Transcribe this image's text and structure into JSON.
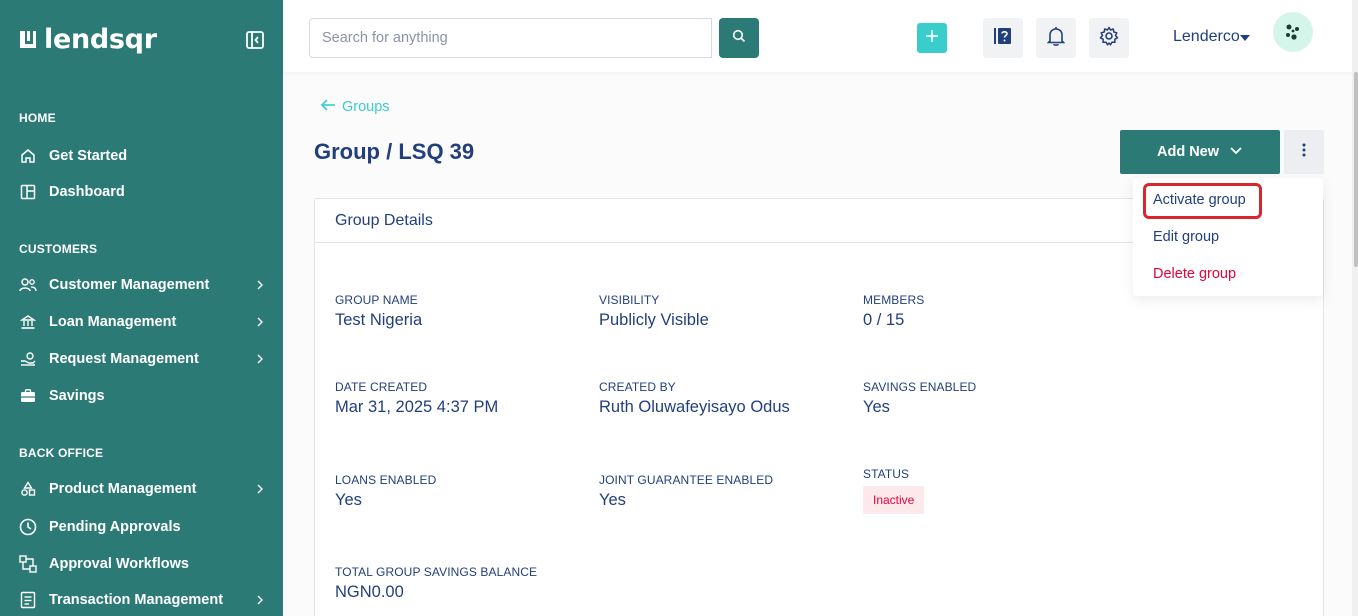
{
  "brand": {
    "name": "lendsqr"
  },
  "sidebar": {
    "sections": [
      {
        "title": "HOME"
      },
      {
        "title": "CUSTOMERS"
      },
      {
        "title": "BACK OFFICE"
      }
    ],
    "items": [
      {
        "label": "Get Started",
        "icon": "home-icon"
      },
      {
        "label": "Dashboard",
        "icon": "dashboard-icon"
      },
      {
        "label": "Customer Management",
        "icon": "users-icon"
      },
      {
        "label": "Loan Management",
        "icon": "loan-icon"
      },
      {
        "label": "Request Management",
        "icon": "request-icon"
      },
      {
        "label": "Savings",
        "icon": "briefcase-icon"
      },
      {
        "label": "Product Management",
        "icon": "product-icon"
      },
      {
        "label": "Pending Approvals",
        "icon": "clock-icon"
      },
      {
        "label": "Approval Workflows",
        "icon": "workflow-icon"
      },
      {
        "label": "Transaction Management",
        "icon": "transaction-icon"
      }
    ]
  },
  "header": {
    "search_placeholder": "Search for anything",
    "user_name": "Lenderco"
  },
  "page": {
    "back_label": "Groups",
    "title": "Group / LSQ 39",
    "add_new_label": "Add New"
  },
  "dropdown": {
    "items": [
      {
        "label": "Activate group"
      },
      {
        "label": "Edit group"
      },
      {
        "label": "Delete group"
      }
    ]
  },
  "details": {
    "card_title": "Group Details",
    "fields": {
      "group_name": {
        "label": "GROUP NAME",
        "value": "Test Nigeria"
      },
      "visibility": {
        "label": "VISIBILITY",
        "value": "Publicly Visible"
      },
      "members": {
        "label": "MEMBERS",
        "value": "0 / 15"
      },
      "date_created": {
        "label": "DATE CREATED",
        "value": "Mar 31, 2025 4:37 PM"
      },
      "created_by": {
        "label": "CREATED BY",
        "value": "Ruth Oluwafeyisayo Odus"
      },
      "savings_enabled": {
        "label": "SAVINGS ENABLED",
        "value": "Yes"
      },
      "loans_enabled": {
        "label": "LOANS ENABLED",
        "value": "Yes"
      },
      "joint_guarantee": {
        "label": "JOINT GUARANTEE ENABLED",
        "value": "Yes"
      },
      "status": {
        "label": "STATUS",
        "value": "Inactive"
      },
      "total_savings": {
        "label": "TOTAL GROUP SAVINGS BALANCE",
        "value": "NGN0.00"
      }
    }
  },
  "colors": {
    "sidebar": "#2c7a76",
    "accent": "#39cdcc",
    "primary_text": "#213f7d",
    "danger": "#e4033b",
    "highlight": "#d9262c"
  }
}
